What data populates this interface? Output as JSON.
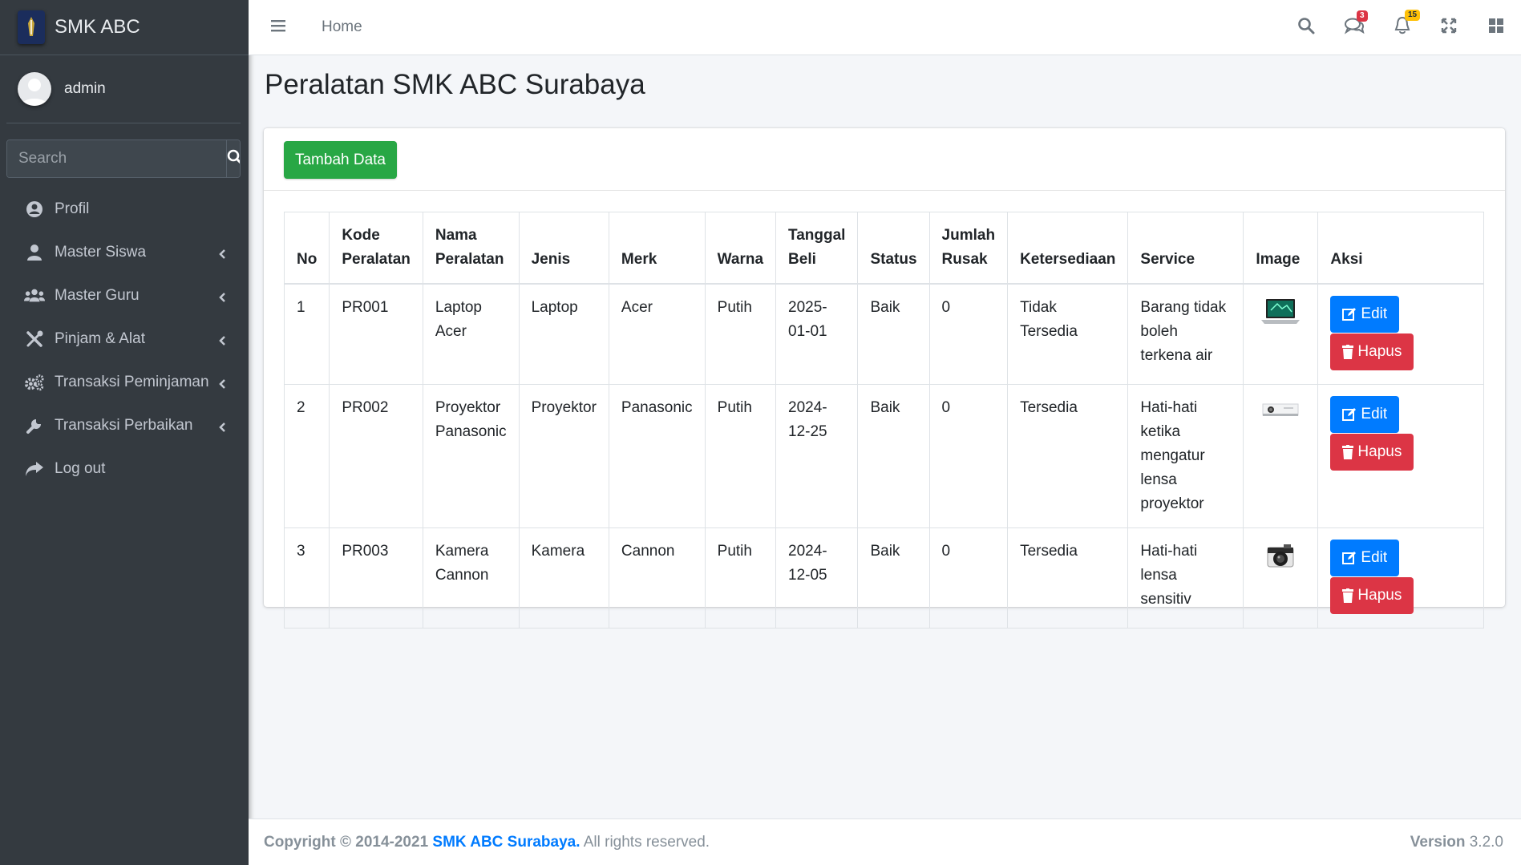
{
  "brand": {
    "name": "SMK ABC"
  },
  "user": {
    "name": "admin"
  },
  "sidebar": {
    "search_placeholder": "Search",
    "items": [
      {
        "label": "Profil",
        "icon": "user-circle-icon"
      },
      {
        "label": "Master Siswa",
        "icon": "user-icon"
      },
      {
        "label": "Master Guru",
        "icon": "users-icon"
      },
      {
        "label": "Pinjam & Alat",
        "icon": "tools-icon"
      },
      {
        "label": "Transaksi Peminjaman",
        "icon": "cogs-icon"
      },
      {
        "label": "Transaksi Perbaikan",
        "icon": "wrench-icon"
      },
      {
        "label": "Log out",
        "icon": "share-icon"
      }
    ]
  },
  "navbar": {
    "home": "Home",
    "messages_count": "3",
    "notifications_count": "15"
  },
  "page": {
    "title": "Peralatan SMK ABC Surabaya",
    "add_button": "Tambah Data"
  },
  "table": {
    "headers": [
      "No",
      "Kode Peralatan",
      "Nama Peralatan",
      "Jenis",
      "Merk",
      "Warna",
      "Tanggal Beli",
      "Status",
      "Jumlah Rusak",
      "Ketersediaan",
      "Service",
      "Image",
      "Aksi"
    ],
    "rows": [
      {
        "no": "1",
        "kode": "PR001",
        "nama": "Laptop Acer",
        "jenis": "Laptop",
        "merk": "Acer",
        "warna": "Putih",
        "tanggal": "2025-01-01",
        "status": "Baik",
        "rusak": "0",
        "ketersediaan": "Tidak Tersedia",
        "service": "Barang tidak boleh terkena air",
        "image": "laptop-image"
      },
      {
        "no": "2",
        "kode": "PR002",
        "nama": "Proyektor Panasonic",
        "jenis": "Proyektor",
        "merk": "Panasonic",
        "warna": "Putih",
        "tanggal": "2024-12-25",
        "status": "Baik",
        "rusak": "0",
        "ketersediaan": "Tersedia",
        "service": "Hati-hati ketika mengatur lensa proyektor",
        "image": "projector-image"
      },
      {
        "no": "3",
        "kode": "PR003",
        "nama": "Kamera Cannon",
        "jenis": "Kamera",
        "merk": "Cannon",
        "warna": "Putih",
        "tanggal": "2024-12-05",
        "status": "Baik",
        "rusak": "0",
        "ketersediaan": "Tersedia",
        "service": "Hati-hati lensa sensitiv",
        "image": "camera-image"
      }
    ],
    "edit_label": "Edit",
    "delete_label": "Hapus"
  },
  "footer": {
    "copyright": "Copyright © 2014-2021",
    "org": "SMK ABC Surabaya.",
    "rights": "All rights reserved.",
    "version_label": "Version",
    "version": "3.2.0"
  },
  "colors": {
    "sidebar": "#343a40",
    "primary": "#007bff",
    "success": "#28a745",
    "danger": "#dc3545"
  }
}
